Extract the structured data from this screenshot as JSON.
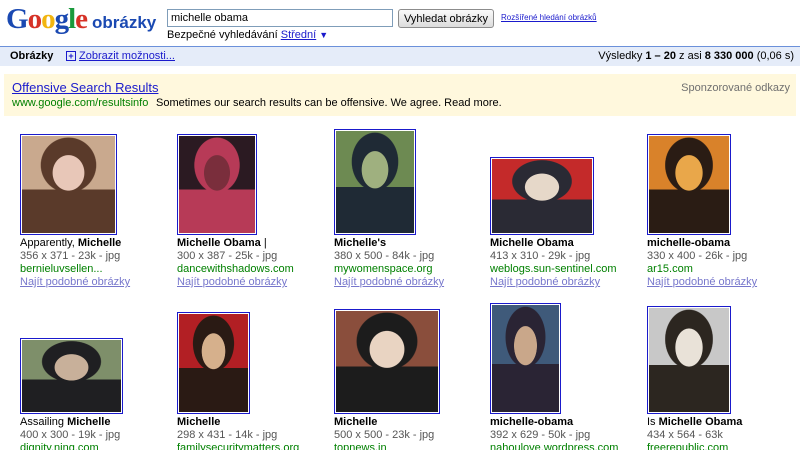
{
  "header": {
    "logo": "Google",
    "logo_sub": "obrázky",
    "search_value": "michelle obama",
    "search_button": "Vyhledat obrázky",
    "advanced_link": "Rozšířené hledání obrázků",
    "safe_label": "Bezpečné vyhledávání",
    "safe_level": "Střední",
    "safe_arrow": "▼"
  },
  "bar": {
    "title": "Obrázky",
    "options_label": "Zobrazit možnosti...",
    "results_prefix": "Výsledky ",
    "results_range": "1 – 20",
    "results_mid": " z asi ",
    "results_total": "8 330 000",
    "results_time": " (0,06 s)"
  },
  "ad": {
    "title": "Offensive Search Results",
    "url": "www.google.com/resultsinfo",
    "text": "Sometimes our search results can be offensive. We agree. Read more.",
    "label": "Sponzorované odkazy"
  },
  "similar_label": "Najít podobné obrázky",
  "results": [
    {
      "title_pre": "Apparently, ",
      "title_bold": "Michelle",
      "meta": "356 x 371 - 23k - jpg",
      "domain": "bernieluvsellen...",
      "show_similar": true
    },
    {
      "title_pre": "",
      "title_bold": "Michelle Obama",
      "title_post": " |",
      "meta": "300 x 387 - 25k - jpg",
      "domain": "dancewithshadows.com",
      "show_similar": true
    },
    {
      "title_pre": "",
      "title_bold": "Michelle's",
      "meta": "380 x 500 - 84k - jpg",
      "domain": "mywomenspace.org",
      "show_similar": true
    },
    {
      "title_pre": "",
      "title_bold": "Michelle Obama",
      "meta": "413 x 310 - 29k - jpg",
      "domain": "weblogs.sun-sentinel.com",
      "show_similar": true
    },
    {
      "title_pre": "",
      "title_bold": "michelle-obama",
      "meta": "330 x 400 - 26k - jpg",
      "domain": "ar15.com",
      "show_similar": true
    },
    {
      "title_pre": "Assailing ",
      "title_bold": "Michelle",
      "meta": "400 x 300 - 19k - jpg",
      "domain": "dignity.ning.com",
      "show_similar": false
    },
    {
      "title_pre": "",
      "title_bold": "Michelle",
      "meta": "298 x 431 - 14k - jpg",
      "domain": "familysecuritymatters.org",
      "show_similar": false
    },
    {
      "title_pre": "",
      "title_bold": "Michelle",
      "meta": "500 x 500 - 23k - jpg",
      "domain": "topnews.in",
      "show_similar": false
    },
    {
      "title_pre": "",
      "title_bold": "michelle-obama",
      "meta": "392 x 629 - 50k - jpg",
      "domain": "nahoulove.wordpress.com",
      "show_similar": false
    },
    {
      "title_pre": "Is ",
      "title_bold": "Michelle Obama",
      "meta": "434 x 564 - 63k",
      "domain": "freerepublic.com",
      "show_similar": false
    }
  ],
  "colors": {
    "link": "#1a1acc",
    "url_green": "#008000",
    "bar_bg": "#e5ecf9",
    "ad_bg": "#fff8dd"
  }
}
